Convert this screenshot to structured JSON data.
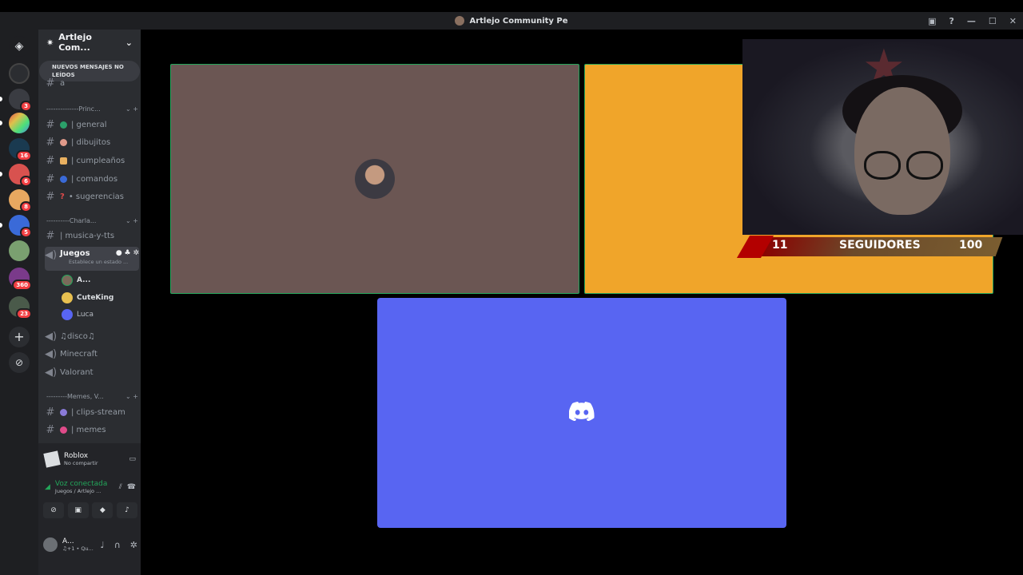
{
  "window": {
    "title": "Artlejo Community Pe"
  },
  "guild": {
    "name": "Artlejo Com...",
    "unread_banner": "NUEVOS MENSAJES NO LEÍDOS"
  },
  "server_badges": [
    "3",
    "16",
    "6",
    "8",
    "5",
    "360",
    "23"
  ],
  "channels": {
    "cut_item": "a",
    "category_1": "--------------Princ...",
    "general": "| general",
    "dibujitos": "| dibujitos",
    "cumpleanos": "| cumpleaños",
    "comandos": "| comandos",
    "sugerencias": "• sugerencias",
    "category_2": "----------Charla...",
    "musica": "| musica-y-tts",
    "juegos": "Juegos",
    "juegos_status": "Establece un estado ...",
    "voice_users": [
      "A...",
      "CuteKing",
      "Luca"
    ],
    "disco": "♫disco♫",
    "minecraft": "Minecraft",
    "valorant": "Valorant",
    "category_3": "---------Memes, V...",
    "clips": "| clips-stream",
    "memes": "| memes"
  },
  "activity": {
    "name": "Roblox",
    "status": "No compartir"
  },
  "voice": {
    "status": "Voz conectada",
    "location": "Juegos / Artlejo ..."
  },
  "user": {
    "name": "A...",
    "status": "♫+1 • Qu..."
  },
  "overlay": {
    "count": "11",
    "label": "SEGUIDORES",
    "goal": "100"
  },
  "colors": {
    "tile_brown": "#6b5653",
    "tile_orange": "#f0a52a",
    "tile_blurple": "#5865f2",
    "speaking_green": "#23a55a"
  }
}
